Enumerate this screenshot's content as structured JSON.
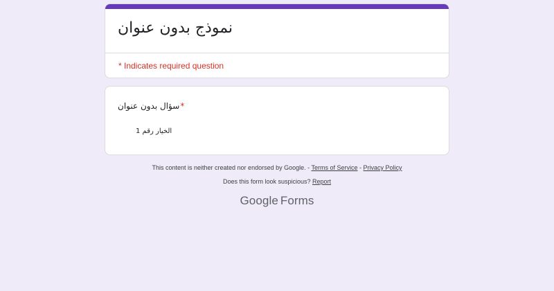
{
  "form": {
    "title": "نموذج بدون عنوان",
    "required_note": "* Indicates required question",
    "accent_color": "#673ab7",
    "background_color": "#efebf8"
  },
  "question": {
    "title": "سؤال بدون عنوان",
    "required_marker": "*",
    "options": [
      {
        "label": "الخيار رقم 1"
      }
    ]
  },
  "footer": {
    "disclaimer": "This content is neither created nor endorsed by Google.",
    "separator1": " - ",
    "terms_label": "Terms of Service",
    "separator2": " - ",
    "privacy_label": "Privacy Policy",
    "suspicious_text": "Does this form look suspicious?",
    "report_label": "Report",
    "logo_google": "Google",
    "logo_forms": "Forms"
  }
}
